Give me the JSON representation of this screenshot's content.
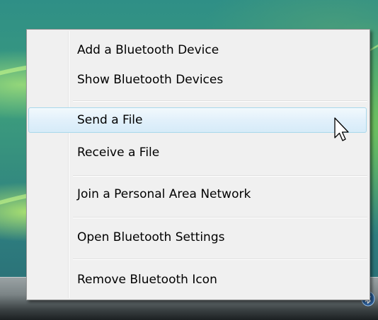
{
  "context_menu": {
    "items": [
      {
        "label": "Add a Bluetooth Device"
      },
      {
        "label": "Show Bluetooth Devices"
      },
      {
        "label": "Send a File"
      },
      {
        "label": "Receive a File"
      },
      {
        "label": "Join a Personal Area Network"
      },
      {
        "label": "Open Bluetooth Settings"
      },
      {
        "label": "Remove Bluetooth Icon"
      }
    ],
    "highlighted_item": "Send a File"
  },
  "icons": {
    "cursor": "mouse-pointer-icon",
    "tray": "bluetooth-tray-icon"
  },
  "colors": {
    "menu_background": "#f0f0f0",
    "highlight_border": "#a8d8eb",
    "highlight_fill": "#e3f1fb"
  }
}
